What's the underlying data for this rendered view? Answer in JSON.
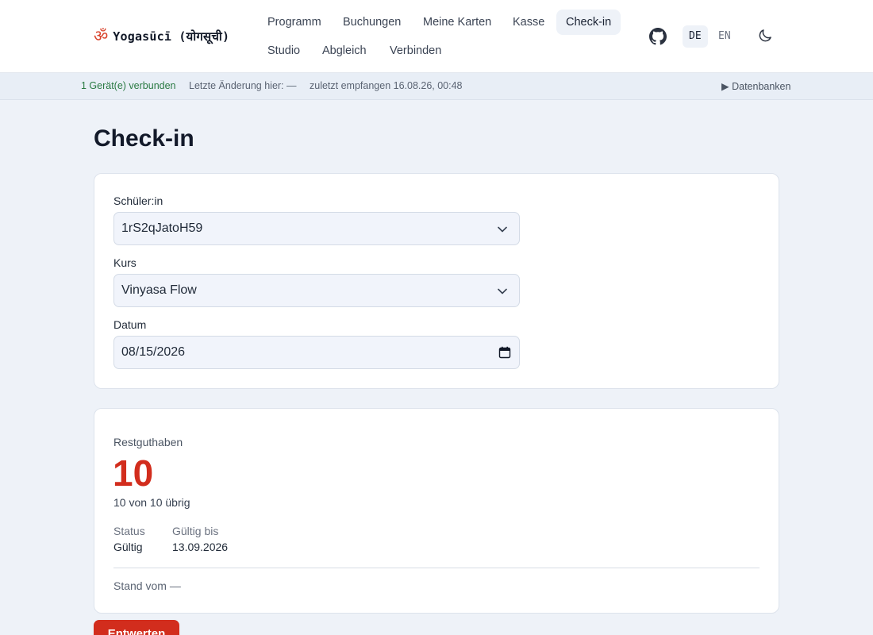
{
  "header": {
    "logo_symbol": "ॐ",
    "logo_text": "Yogasūcī (योगसूची)",
    "nav": [
      {
        "label": "Programm"
      },
      {
        "label": "Buchungen"
      },
      {
        "label": "Meine Karten"
      },
      {
        "label": "Kasse"
      },
      {
        "label": "Check-in",
        "active": true
      },
      {
        "label": "Studio"
      },
      {
        "label": "Abgleich"
      },
      {
        "label": "Verbinden"
      }
    ],
    "lang_de": "DE",
    "lang_en": "EN",
    "icons": [
      "github-icon",
      "moon-icon"
    ]
  },
  "status": {
    "connected": "1 Gerät(e) verbunden",
    "last_change": "Letzte Änderung hier: —",
    "received": "zuletzt empfangen 16.08.26, 00:48",
    "databases": "▶ Datenbanken"
  },
  "page": {
    "title": "Check-in"
  },
  "form": {
    "student_label": "Schüler:in",
    "student_value": "1rS2qJatoH59",
    "course_label": "Kurs",
    "course_value": "Vinyasa Flow",
    "date_label": "Datum",
    "date_value": "08/15/2026"
  },
  "balance": {
    "label": "Restguthaben",
    "value": "10",
    "sub": "10 von 10 übrig",
    "status_label": "Status",
    "status_value": "Gültig",
    "valid_label": "Gültig bis",
    "valid_value": "13.09.2026",
    "as_of": "Stand vom —"
  },
  "actions": {
    "cancel_label": "Entwerten"
  },
  "colors": {
    "accent_red": "#d22d1d",
    "connected_green": "#2a7a43",
    "background": "#eef2f8"
  }
}
